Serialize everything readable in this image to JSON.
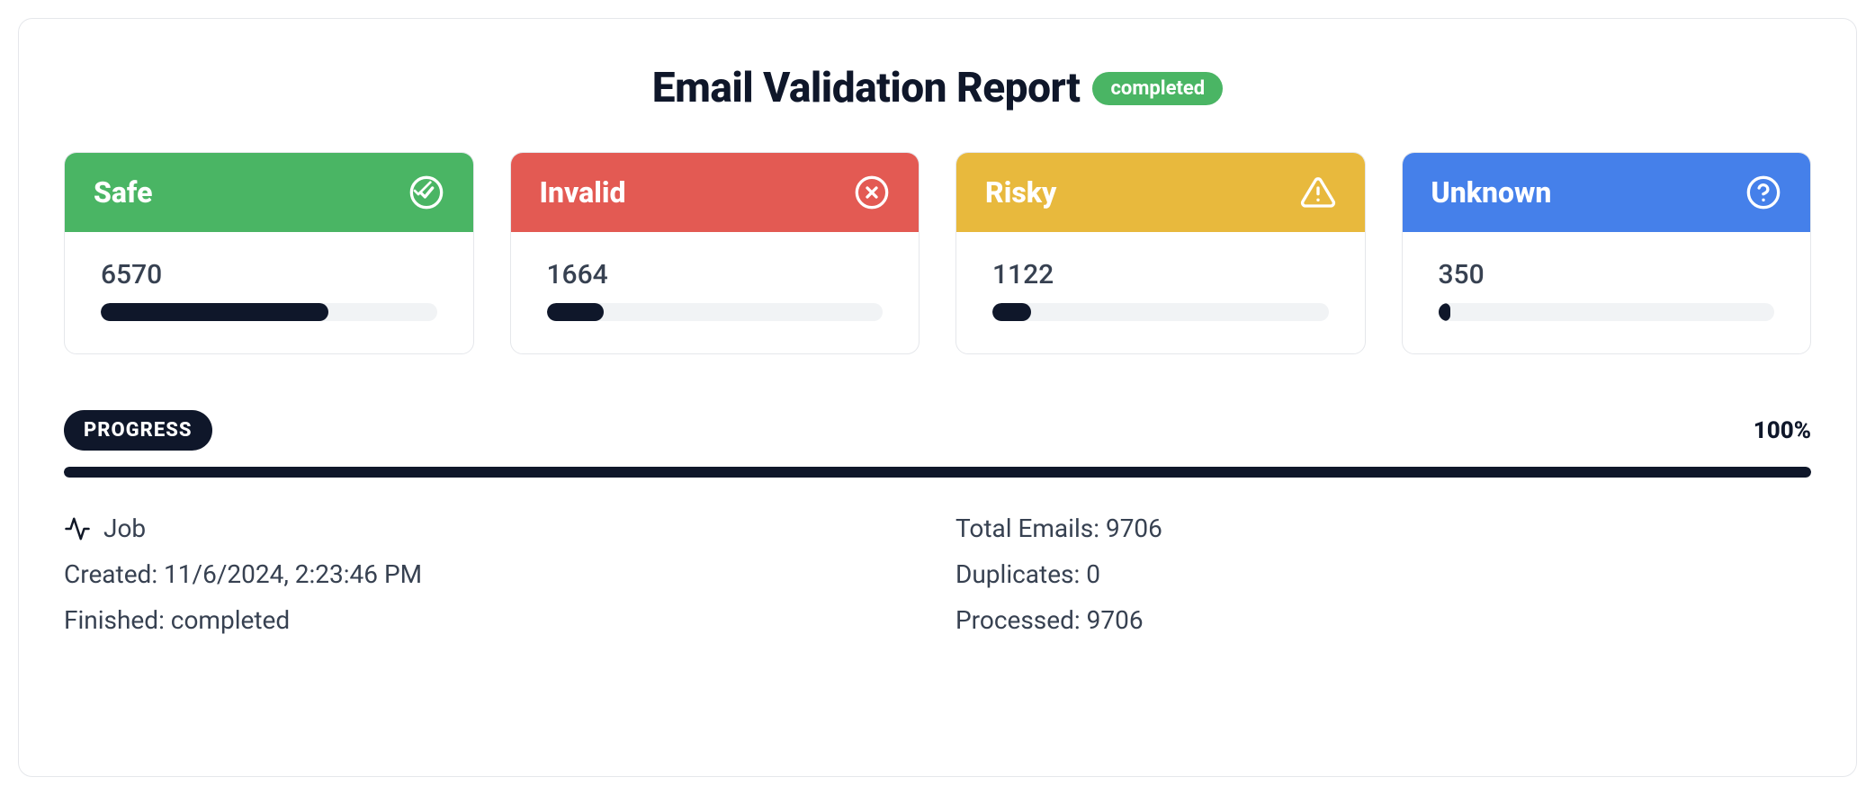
{
  "header": {
    "title": "Email Validation Report",
    "status": "completed"
  },
  "cards": {
    "safe": {
      "label": "Safe",
      "count": "6570",
      "percent": 67.7
    },
    "invalid": {
      "label": "Invalid",
      "count": "1664",
      "percent": 17.1
    },
    "risky": {
      "label": "Risky",
      "count": "1122",
      "percent": 11.6
    },
    "unknown": {
      "label": "Unknown",
      "count": "350",
      "percent": 3.6
    }
  },
  "progress": {
    "label": "PROGRESS",
    "percent_label": "100%",
    "percent": 100
  },
  "job": {
    "label": "Job",
    "created": "Created: 11/6/2024, 2:23:46 PM",
    "finished": "Finished: completed",
    "total": "Total Emails: 9706",
    "duplicates": "Duplicates: 0",
    "processed": "Processed: 9706"
  },
  "chart_data": {
    "type": "bar",
    "title": "Email Validation Report",
    "categories": [
      "Safe",
      "Invalid",
      "Risky",
      "Unknown"
    ],
    "values": [
      6570,
      1664,
      1122,
      350
    ],
    "total": 9706,
    "progress_percent": 100
  }
}
